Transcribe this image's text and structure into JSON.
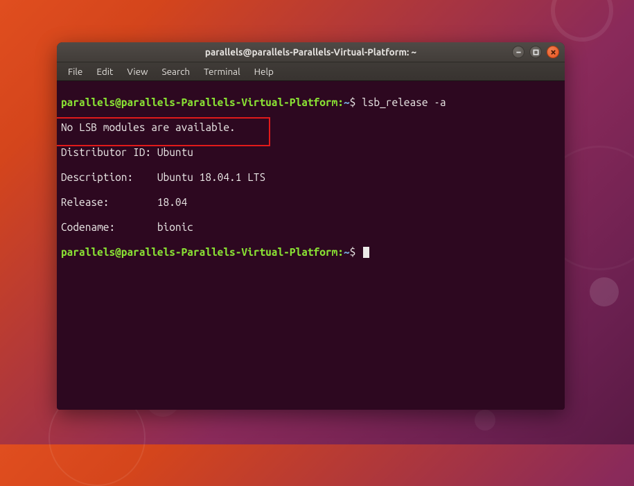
{
  "window": {
    "title": "parallels@parallels-Parallels-Virtual-Platform: ~"
  },
  "menubar": {
    "file": "File",
    "edit": "Edit",
    "view": "View",
    "search": "Search",
    "terminal": "Terminal",
    "help": "Help"
  },
  "prompt": {
    "user_host": "parallels@parallels-Parallels-Virtual-Platform",
    "colon": ":",
    "path": "~",
    "dollar": "$"
  },
  "cmd1": "lsb_release -a",
  "output": {
    "line1": "No LSB modules are available.",
    "line2": "Distributor ID: Ubuntu",
    "line3": "Description:    Ubuntu 18.04.1 LTS",
    "line4": "Release:        18.04",
    "line5": "Codename:       bionic"
  }
}
